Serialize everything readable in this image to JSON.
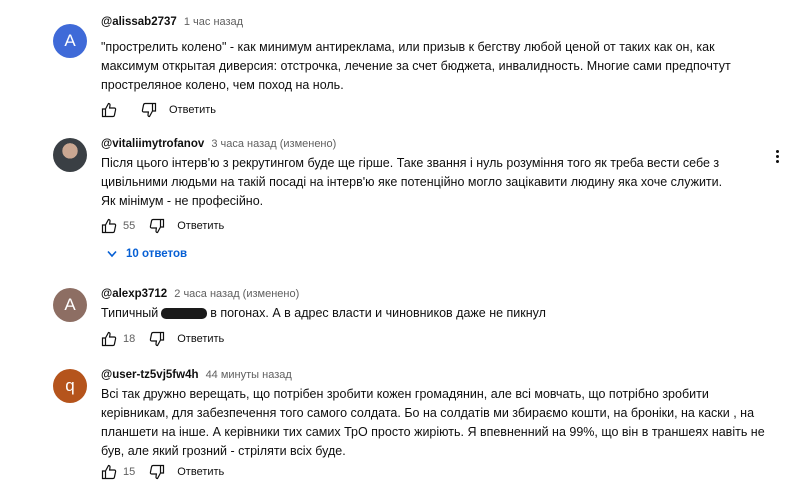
{
  "comments": [
    {
      "avatar_letter": "A",
      "avatar_color": "#3f6ad8",
      "author": "@alissab2737",
      "time": "1 час назад",
      "lines": [
        "\"прострелить колено\" - как минимум антиреклама, или призыв к бегству любой ценой от таких как он, как",
        "максимум открытая диверсия: отстрочка, лечение за счет бюджета, инвалидность.  Многие сами предпочтут",
        "простреляное колено, чем поход на ноль."
      ],
      "likes": "",
      "reply_label": "Ответить"
    },
    {
      "avatar_letter": "",
      "avatar_color": "#3a3f44",
      "author": "@vitaliimytrofanov",
      "time": "3 часа назад (изменено)",
      "lines": [
        "Після цього інтерв'ю з рекрутингом буде ще гірше. Таке звання і нуль розуміння того як треба вести себе з",
        "цивільними людьми на такій посаді на інтерв'ю яке потенційно могло зацікавити людину яка хоче служити.",
        "Як мінімум - не професійно."
      ],
      "likes": "55",
      "reply_label": "Ответить",
      "replies_label": "10 ответов"
    },
    {
      "avatar_letter": "A",
      "avatar_color": "#8d6e63",
      "author": "@alexp3712",
      "time": "2 часа назад (изменено)",
      "text_before": "Типичный",
      "text_after": "в погонах. А в адрес власти и чиновников даже не пикнул",
      "likes": "18",
      "reply_label": "Ответить"
    },
    {
      "avatar_letter": "q",
      "avatar_color": "#b5541c",
      "author": "@user-tz5vj5fw4h",
      "time": "44 минуты назад",
      "lines": [
        "Всі так дружно верещать, що потрібен зробити кожен громадянин, але всі мовчать, що потрібно зробити",
        "керівникам, для забезпечення того самого солдата. Бо на солдатів ми збираємо кошти, на броніки, на каски , на",
        "планшети на інше. А керівники тих самих ТрО просто жиріють. Я впевненний на 99%, що він в траншеях навіть не",
        "був, але який грозний - стріляти всіх буде."
      ],
      "likes": "15",
      "reply_label": "Ответить"
    }
  ]
}
